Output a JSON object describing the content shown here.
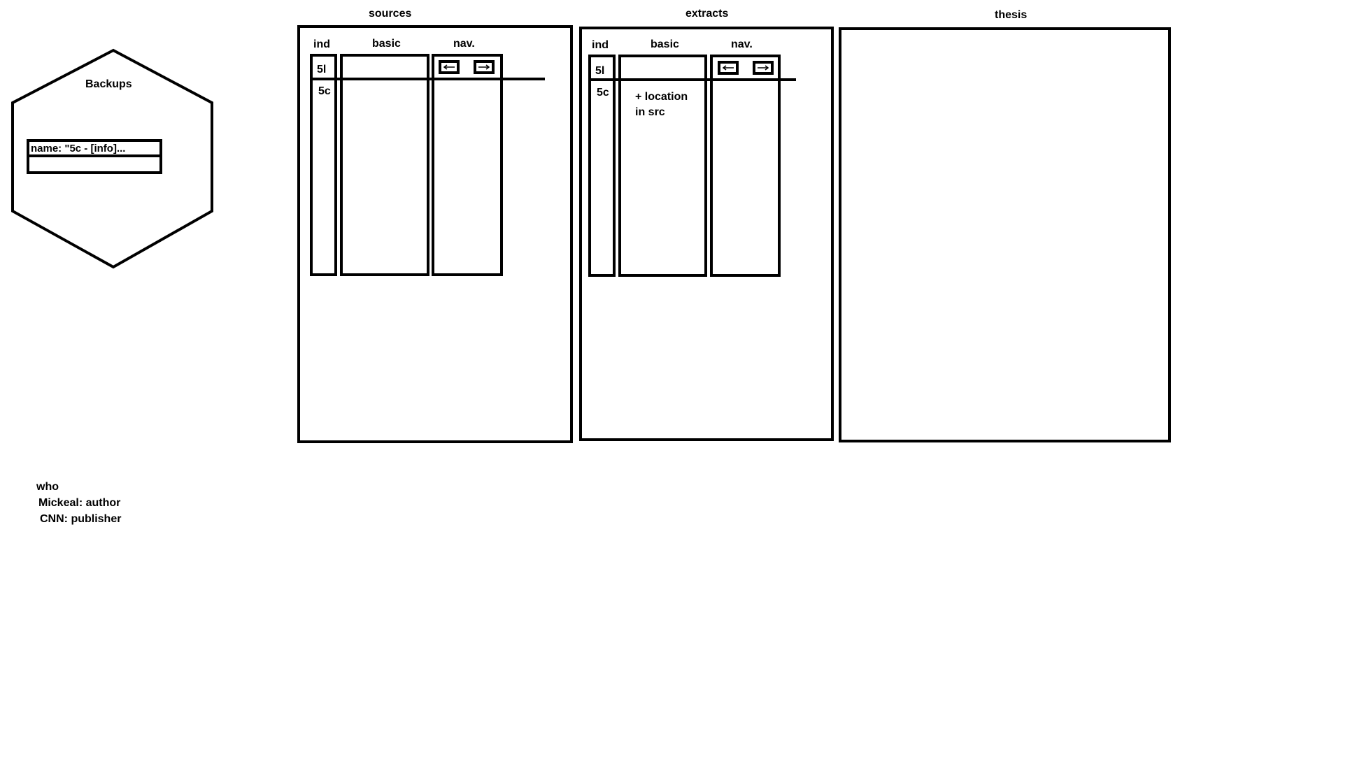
{
  "backups": {
    "title": "Backups",
    "name_field_value": "name: \"5c - [info]...",
    "second_field_value": ""
  },
  "sources": {
    "title": "sources",
    "col_ind": "ind",
    "col_basic": "basic",
    "col_nav": "nav.",
    "row1_ind": "5l",
    "row2_ind": "5c"
  },
  "extracts": {
    "title": "extracts",
    "col_ind": "ind",
    "col_basic": "basic",
    "col_nav": "nav.",
    "row1_ind": "5l",
    "row2_ind": "5c",
    "basic_note_line1": "+ location",
    "basic_note_line2": "in src"
  },
  "thesis": {
    "title": "thesis"
  },
  "who": {
    "heading": "who",
    "line1": "Mickeal: author",
    "line2": "CNN: publisher"
  },
  "icons": {
    "prev": "left-arrow-icon",
    "next": "right-arrow-icon"
  }
}
